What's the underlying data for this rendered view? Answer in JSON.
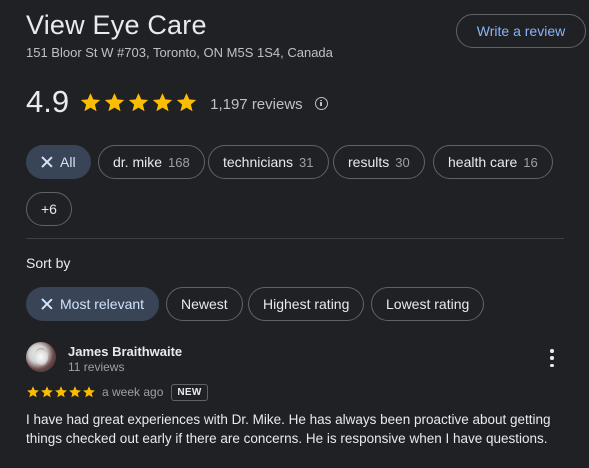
{
  "header": {
    "title": "View Eye Care",
    "address": "151 Bloor St W #703, Toronto, ON M5S 1S4, Canada",
    "write_review_label": "Write a review"
  },
  "rating": {
    "value": "4.9",
    "stars": 5,
    "review_count": "1,197 reviews",
    "star_color": "#fbbc04"
  },
  "topic_filters": [
    {
      "label": "All",
      "count": "",
      "selected": true
    },
    {
      "label": "dr. mike",
      "count": "168",
      "selected": false
    },
    {
      "label": "technicians",
      "count": "31",
      "selected": false
    },
    {
      "label": "results",
      "count": "30",
      "selected": false
    },
    {
      "label": "health care",
      "count": "16",
      "selected": false
    },
    {
      "label": "+6",
      "count": "",
      "selected": false
    }
  ],
  "sort": {
    "label": "Sort by",
    "options": [
      {
        "label": "Most relevant",
        "selected": true
      },
      {
        "label": "Newest",
        "selected": false
      },
      {
        "label": "Highest rating",
        "selected": false
      },
      {
        "label": "Lowest rating",
        "selected": false
      }
    ]
  },
  "reviews": [
    {
      "name": "James Braithwaite",
      "meta": "11 reviews",
      "stars": 5,
      "date": "a week ago",
      "badge": "NEW",
      "text": "I have had great experiences with Dr. Mike. He has always been proactive about getting things checked out early if there are concerns. He is responsive when I have questions."
    }
  ],
  "colors": {
    "background": "#202124",
    "accent": "#8ab4f8",
    "selected_chip": "#394457"
  }
}
